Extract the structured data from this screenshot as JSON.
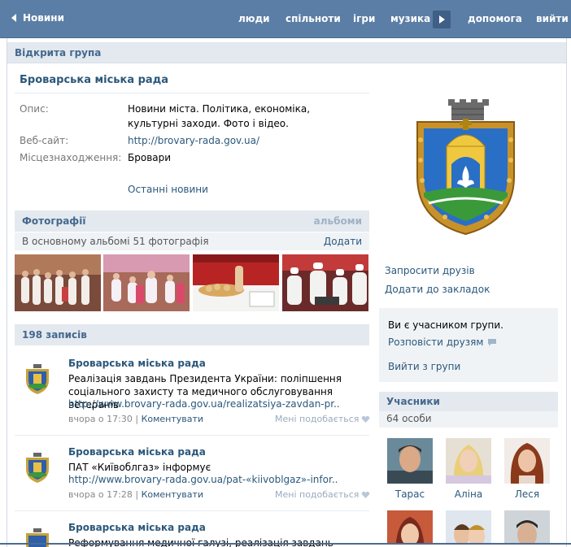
{
  "topnav": {
    "back": "Новини",
    "items": [
      "люди",
      "спільноти",
      "ігри",
      "музика",
      "допомога",
      "вийти"
    ]
  },
  "group": {
    "type": "Відкрита група",
    "name": "Броварська міська рада",
    "info": {
      "desc_label": "Опис:",
      "desc_value": "Новини міста. Політика, економіка, культурні заходи. Фото і відео.",
      "site_label": "Веб-сайт:",
      "site_value": "http://brovary-rada.gov.ua/",
      "loc_label": "Місцезнаходження:",
      "loc_value": "Бровари",
      "latest": "Останні новини"
    }
  },
  "photos": {
    "title": "Фотографії",
    "albums": "альбоми",
    "summary": "В основному альбомі 51 фотографія",
    "add": "Додати",
    "count_shown": 4
  },
  "wall": {
    "title": "198 записів",
    "posts": [
      {
        "author": "Броварська міська рада",
        "text": "Реалізація завдань Президента України: поліпшення соціального захисту та медичного обслуговування ветеранів",
        "link": "http://www.brovary-rada.gov.ua/realizatsiya-zavdan-pr..",
        "time": "вчора о 17:30",
        "comment": "Коментувати",
        "like": "Мені подобається"
      },
      {
        "author": "Броварська міська рада",
        "text": "ПАТ «Київоблгаз» інформує",
        "link": "http://www.brovary-rada.gov.ua/pat-«kiivoblgaz»-infor..",
        "time": "вчора о 17:28",
        "comment": "Коментувати",
        "like": "Мені подобається"
      },
      {
        "author": "Броварська міська рада",
        "text": "Реформування медичної галузі, реалізація завдань Глави"
      }
    ]
  },
  "sidebar": {
    "invite": "Запросити друзів",
    "bookmark": "Додати до закладок",
    "member_status": "Ви є учасником групи.",
    "share": "Розповісти друзям",
    "leave": "Вийти з групи",
    "members_title": "Учасники",
    "members_count": "64 особи",
    "members": [
      {
        "name": "Тарас"
      },
      {
        "name": "Аліна"
      },
      {
        "name": "Леся"
      },
      {
        "name": ""
      },
      {
        "name": ""
      },
      {
        "name": ""
      }
    ]
  },
  "colors": {
    "nav": "#5b7ea6",
    "link": "#2b587a",
    "header_bg": "#e3e9ef",
    "header_text": "#45688e"
  }
}
